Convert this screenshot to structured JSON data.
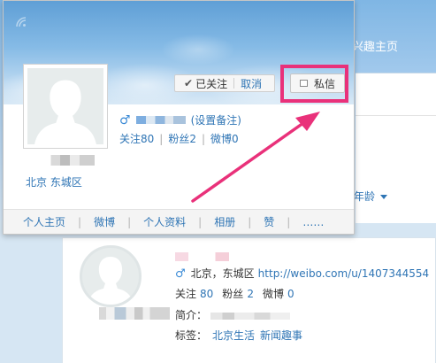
{
  "background": {
    "top_link": "兴趣主页",
    "age_filter": "年龄",
    "profile": {
      "location": "北京，东城区",
      "url": "http://weibo.com/u/1407344554",
      "stats": [
        {
          "label": "关注",
          "value": "80"
        },
        {
          "label": "粉丝",
          "value": "2"
        },
        {
          "label": "微博",
          "value": "0"
        }
      ],
      "intro_label": "简介：",
      "tags_label": "标签：",
      "tags": [
        "北京生活",
        "新闻趣事"
      ]
    }
  },
  "card": {
    "followed_label": "已关注",
    "cancel_label": "取消",
    "message_label": "私信",
    "remark_label": "(设置备注)",
    "stats": {
      "following": "关注80",
      "followers": "粉丝2",
      "posts": "微博0"
    },
    "location": "北京 东城区",
    "nav": [
      "个人主页",
      "微博",
      "个人资料",
      "相册",
      "赞",
      "……"
    ]
  },
  "colors": {
    "link": "#2f75b5",
    "highlight": "#e9317a",
    "male_icon": "#3a8ad6"
  },
  "icons": {
    "gender": "male-icon",
    "check": "check-icon",
    "message": "mail-icon"
  }
}
